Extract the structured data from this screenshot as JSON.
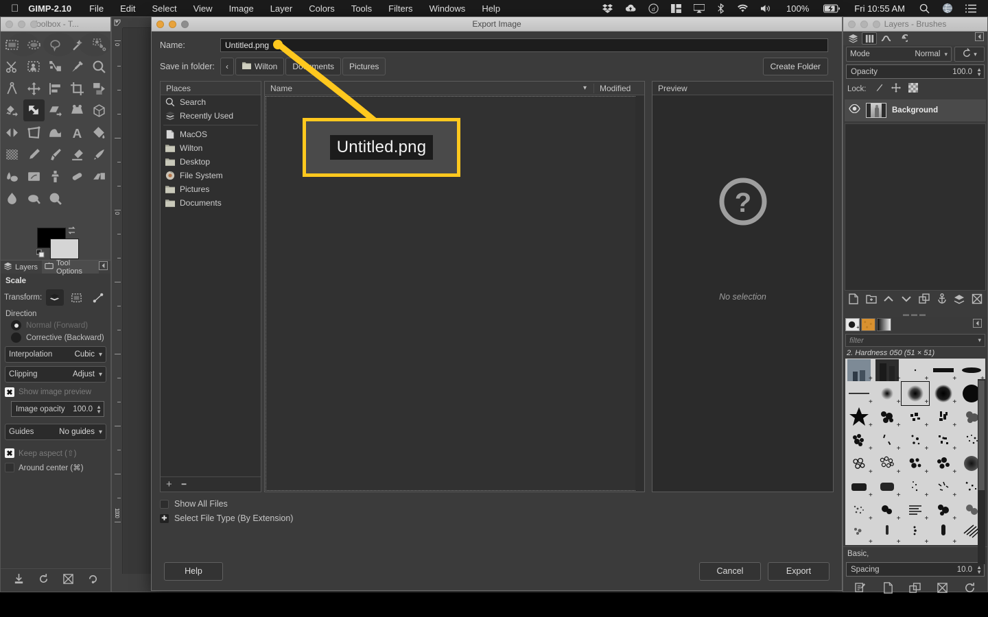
{
  "menubar": {
    "apple_icon": "apple-icon",
    "app_name": "GIMP-2.10",
    "items": [
      "File",
      "Edit",
      "Select",
      "View",
      "Image",
      "Layer",
      "Colors",
      "Tools",
      "Filters",
      "Windows",
      "Help"
    ],
    "status_icons": [
      "dropbox-icon",
      "cloud-upload-icon",
      "circle-d-icon",
      "grid-panel-icon",
      "airplay-icon",
      "bluetooth-icon",
      "wifi-icon",
      "volume-icon"
    ],
    "battery_percent": "100%",
    "battery_icon": "battery-charging-icon",
    "clock": "Fri 10:55 AM",
    "right_icons": [
      "search-icon",
      "globe-icon",
      "list-icon"
    ]
  },
  "toolbox": {
    "title": "Toolbox - T...",
    "tools": [
      "rect-select-tool",
      "ellipse-select-tool",
      "free-select-tool",
      "fuzzy-select-tool",
      "select-by-color-tool",
      "scissors-select-tool",
      "foreground-select-tool",
      "paths-tool",
      "color-picker-tool",
      "zoom-tool",
      "measure-tool",
      "move-tool",
      "alignment-tool",
      "crop-tool",
      "rotate-tool",
      "unified-transform-tool",
      "scale-tool",
      "shear-tool",
      "perspective-tool",
      "3d-transform-tool",
      "flip-tool",
      "handle-transform-tool",
      "warp-transform-tool",
      "text-tool",
      "bucket-fill-tool",
      "gradient-tool",
      "pencil-tool",
      "paintbrush-tool",
      "eraser-tool",
      "airbrush-tool",
      "ink-tool",
      "mypaint-brush-tool",
      "clone-tool",
      "heal-tool",
      "perspective-clone-tool",
      "blur-sharpen-tool",
      "smudge-tool",
      "dodge-burn-tool"
    ],
    "foreground_color": "#000000",
    "background_color": "#d5d5d5",
    "swap_icon": "swap-colors-icon",
    "reset_icon": "reset-colors-icon"
  },
  "tool_options": {
    "tabs": [
      {
        "label": "Layers",
        "icon": "layers-icon",
        "selected": false
      },
      {
        "label": "Tool Options",
        "icon": "tool-options-icon",
        "selected": true
      }
    ],
    "menu_icon": "dock-menu-icon",
    "title": "Scale",
    "transform_label": "Transform:",
    "transform_buttons": [
      "transform-layer-icon",
      "transform-selection-icon",
      "transform-path-icon"
    ],
    "transform_selected_index": 0,
    "direction_label": "Direction",
    "direction_options": [
      {
        "label": "Normal (Forward)",
        "selected": true
      },
      {
        "label": "Corrective (Backward)",
        "selected": false
      }
    ],
    "interpolation": {
      "label": "Interpolation",
      "value": "Cubic"
    },
    "clipping": {
      "label": "Clipping",
      "value": "Adjust"
    },
    "show_image_preview": {
      "label": "Show image preview",
      "checked": true
    },
    "image_opacity": {
      "label": "Image opacity",
      "value": "100.0"
    },
    "guides": {
      "label": "Guides",
      "value": "No guides"
    },
    "keep_aspect": {
      "label": "Keep aspect (⇧)",
      "checked": true
    },
    "around_center": {
      "label": "Around center (⌘)",
      "checked": false
    },
    "bottom_icons": [
      "save-tool-options-icon",
      "restore-tool-options-icon",
      "delete-tool-options-icon",
      "reset-tool-options-icon"
    ]
  },
  "dialog": {
    "title": "Export Image",
    "window_buttons": [
      "close-button",
      "minimize-button",
      "zoom-button"
    ],
    "name": {
      "label": "Name:",
      "value": "Untitled.png",
      "placeholder": "Untitled.png"
    },
    "save_in_folder": {
      "label": "Save in folder:",
      "back_icon": "chevron-left-icon",
      "crumbs": [
        {
          "label": "Wilton",
          "icon": "folder-icon",
          "selected": false
        },
        {
          "label": "Documents",
          "icon": "",
          "selected": false
        },
        {
          "label": "Pictures",
          "icon": "",
          "selected": true
        }
      ]
    },
    "create_folder_label": "Create Folder",
    "places": {
      "header": "Places",
      "items": [
        {
          "label": "Search",
          "icon": "search-icon"
        },
        {
          "label": "Recently Used",
          "icon": "recent-icon"
        },
        {
          "label": "MacOS",
          "icon": "document-icon"
        },
        {
          "label": "Wilton",
          "icon": "folder-icon"
        },
        {
          "label": "Desktop",
          "icon": "folder-icon"
        },
        {
          "label": "File System",
          "icon": "drive-icon"
        },
        {
          "label": "Pictures",
          "icon": "folder-icon"
        },
        {
          "label": "Documents",
          "icon": "folder-icon"
        }
      ],
      "footer_icons": [
        "add-place-icon",
        "remove-place-icon"
      ]
    },
    "filelist": {
      "columns": [
        "Name",
        "Modified"
      ],
      "sort_icon": "chevron-down-icon",
      "rows": []
    },
    "preview": {
      "header": "Preview",
      "icon": "question-mark-icon",
      "status": "No selection"
    },
    "show_all_files": {
      "label": "Show All Files",
      "checked": false
    },
    "select_file_type": {
      "label": "Select File Type (By Extension)",
      "expanded": false
    },
    "buttons": {
      "help": "Help",
      "cancel": "Cancel",
      "export": "Export"
    }
  },
  "callout": {
    "text": "Untitled.png",
    "border_color": "#FFC81E"
  },
  "right_dock": {
    "title": "Layers - Brushes",
    "window_buttons": [
      "close-button",
      "minimize-button",
      "zoom-button"
    ],
    "tabs": [
      "layers-icon",
      "channels-icon",
      "paths-icon",
      "undo-history-icon"
    ],
    "selected_tab_index": 1,
    "menu_icon": "dock-menu-icon",
    "mode": {
      "label": "Mode",
      "value": "Normal"
    },
    "mode_extra_icon": "blend-space-icon",
    "opacity": {
      "label": "Opacity",
      "value": "100.0"
    },
    "lock": {
      "label": "Lock:",
      "icons": [
        "lock-pixels-icon",
        "lock-position-icon",
        "lock-alpha-icon"
      ]
    },
    "layers": [
      {
        "name": "Background",
        "visible": true,
        "visibility_icon": "eye-icon"
      }
    ],
    "layer_toolbar_icons": [
      "new-layer-icon",
      "new-group-icon",
      "raise-layer-icon",
      "lower-layer-icon",
      "duplicate-layer-icon",
      "anchor-layer-icon",
      "merge-down-icon",
      "delete-layer-icon"
    ],
    "brush_tabs": [
      "brushes-icon",
      "patterns-icon",
      "gradients-icon"
    ],
    "brush_selected_tab_index": 0,
    "filter": {
      "placeholder": "filter",
      "chevron": "chevron-down-icon"
    },
    "brush_label": "2. Hardness 050 (51 × 51)",
    "brush_selected_index": 7,
    "brush_tag": {
      "label": "Basic,",
      "chevron": "chevron-down-icon"
    },
    "spacing": {
      "label": "Spacing",
      "value": "10.0"
    },
    "bottom_icons": [
      "edit-brush-icon",
      "new-brush-icon",
      "duplicate-brush-icon",
      "delete-brush-icon",
      "refresh-brushes-icon"
    ]
  }
}
